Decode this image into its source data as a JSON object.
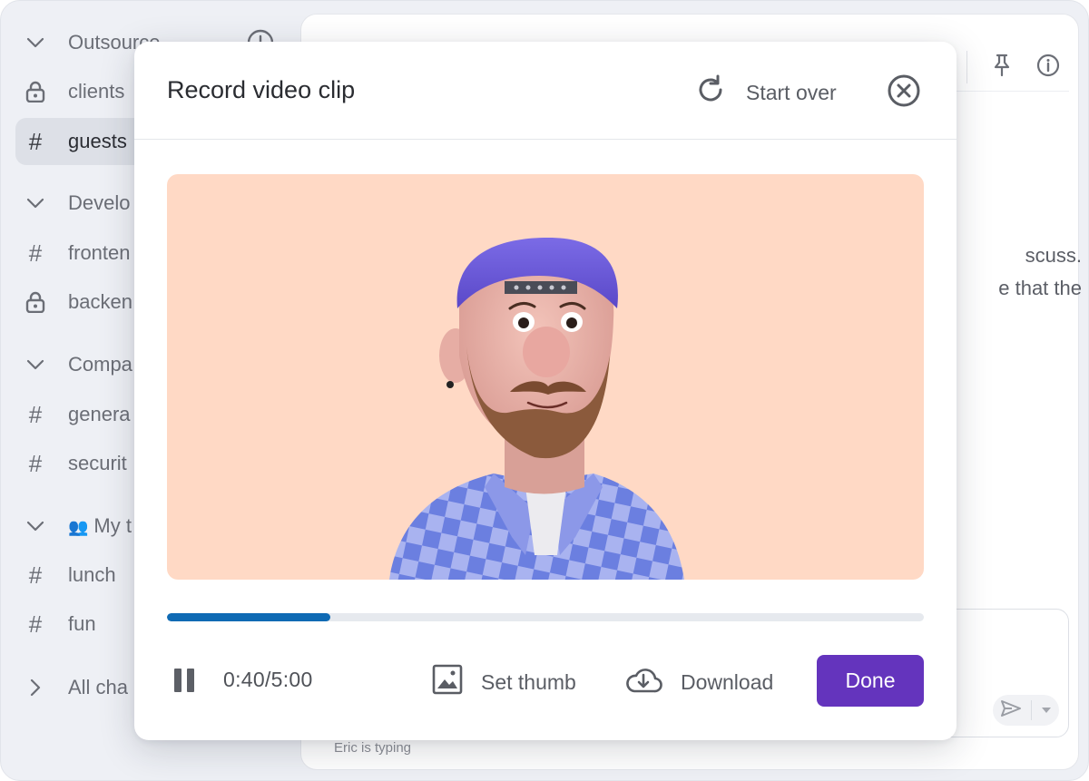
{
  "sidebar": {
    "items": [
      {
        "type": "section",
        "label": "Outsource"
      },
      {
        "type": "lock",
        "label": "clients"
      },
      {
        "type": "hash",
        "label": "guests",
        "active": true
      },
      {
        "type": "section",
        "label": "Develo"
      },
      {
        "type": "hash",
        "label": "fronten"
      },
      {
        "type": "lock",
        "label": "backen"
      },
      {
        "type": "section",
        "label": "Compa"
      },
      {
        "type": "hash",
        "label": "genera"
      },
      {
        "type": "hash",
        "label": "securit"
      },
      {
        "type": "section",
        "label": "My t",
        "emoji": "👥"
      },
      {
        "type": "hash",
        "label": "lunch"
      },
      {
        "type": "hash",
        "label": "fun"
      },
      {
        "type": "collapsed",
        "label": "All cha"
      }
    ]
  },
  "chat": {
    "text_line_1": "scuss.",
    "text_line_2": "e that the",
    "typing": "Eric is typing"
  },
  "modal": {
    "title": "Record video clip",
    "start_over_label": "Start over",
    "progress_fraction": 0.216,
    "time": "0:40/5:00",
    "set_thumb_label": "Set thumb",
    "download_label": "Download",
    "done_label": "Done"
  },
  "colors": {
    "accent": "#6434bd",
    "progress": "#0f6ab4",
    "video_bg": "#ffd9c5"
  }
}
